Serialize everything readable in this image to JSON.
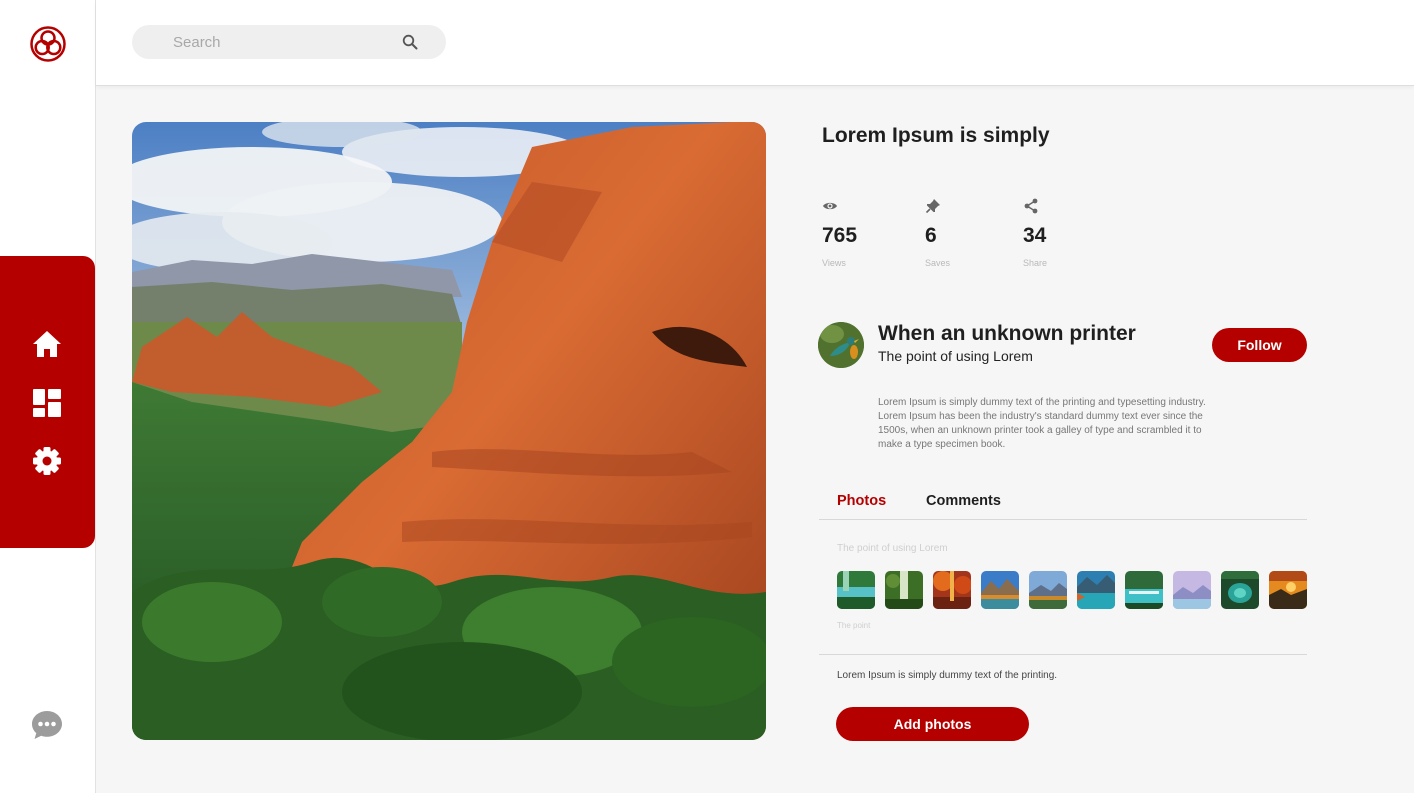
{
  "app": {
    "logo_icon": "film-reel-logo-icon",
    "accent_color": "#b50000"
  },
  "sidebar": {
    "items": [
      {
        "icon": "home-icon"
      },
      {
        "icon": "dashboard-icon"
      },
      {
        "icon": "gear-icon"
      }
    ],
    "chat_icon": "chat-bubble-icon"
  },
  "search": {
    "placeholder": "Search",
    "icon": "search-icon"
  },
  "post": {
    "title": "Lorem Ipsum is simply",
    "stats": [
      {
        "icon": "eye-icon",
        "value": "765",
        "label": "Views"
      },
      {
        "icon": "pin-icon",
        "value": "6",
        "label": "Saves"
      },
      {
        "icon": "share-icon",
        "value": "34",
        "label": "Share"
      }
    ],
    "author": {
      "name": "When an unknown printer",
      "subtitle": "The point of using Lorem",
      "follow_label": "Follow"
    },
    "description": "Lorem Ipsum is simply dummy text of the printing and typesetting industry. Lorem Ipsum has been the industry's standard dummy text ever since the 1500s, when an unknown printer took a galley of type and scrambled it to make a type specimen book."
  },
  "tabs": [
    {
      "label": "Photos",
      "active": true
    },
    {
      "label": "Comments",
      "active": false
    }
  ],
  "photos": {
    "caption_top": "The point of using Lorem",
    "caption_bottom": "The point",
    "thumbnail_count": 10
  },
  "footer": {
    "note": "Lorem Ipsum is simply dummy text of the printing.",
    "add_label": "Add photos"
  }
}
